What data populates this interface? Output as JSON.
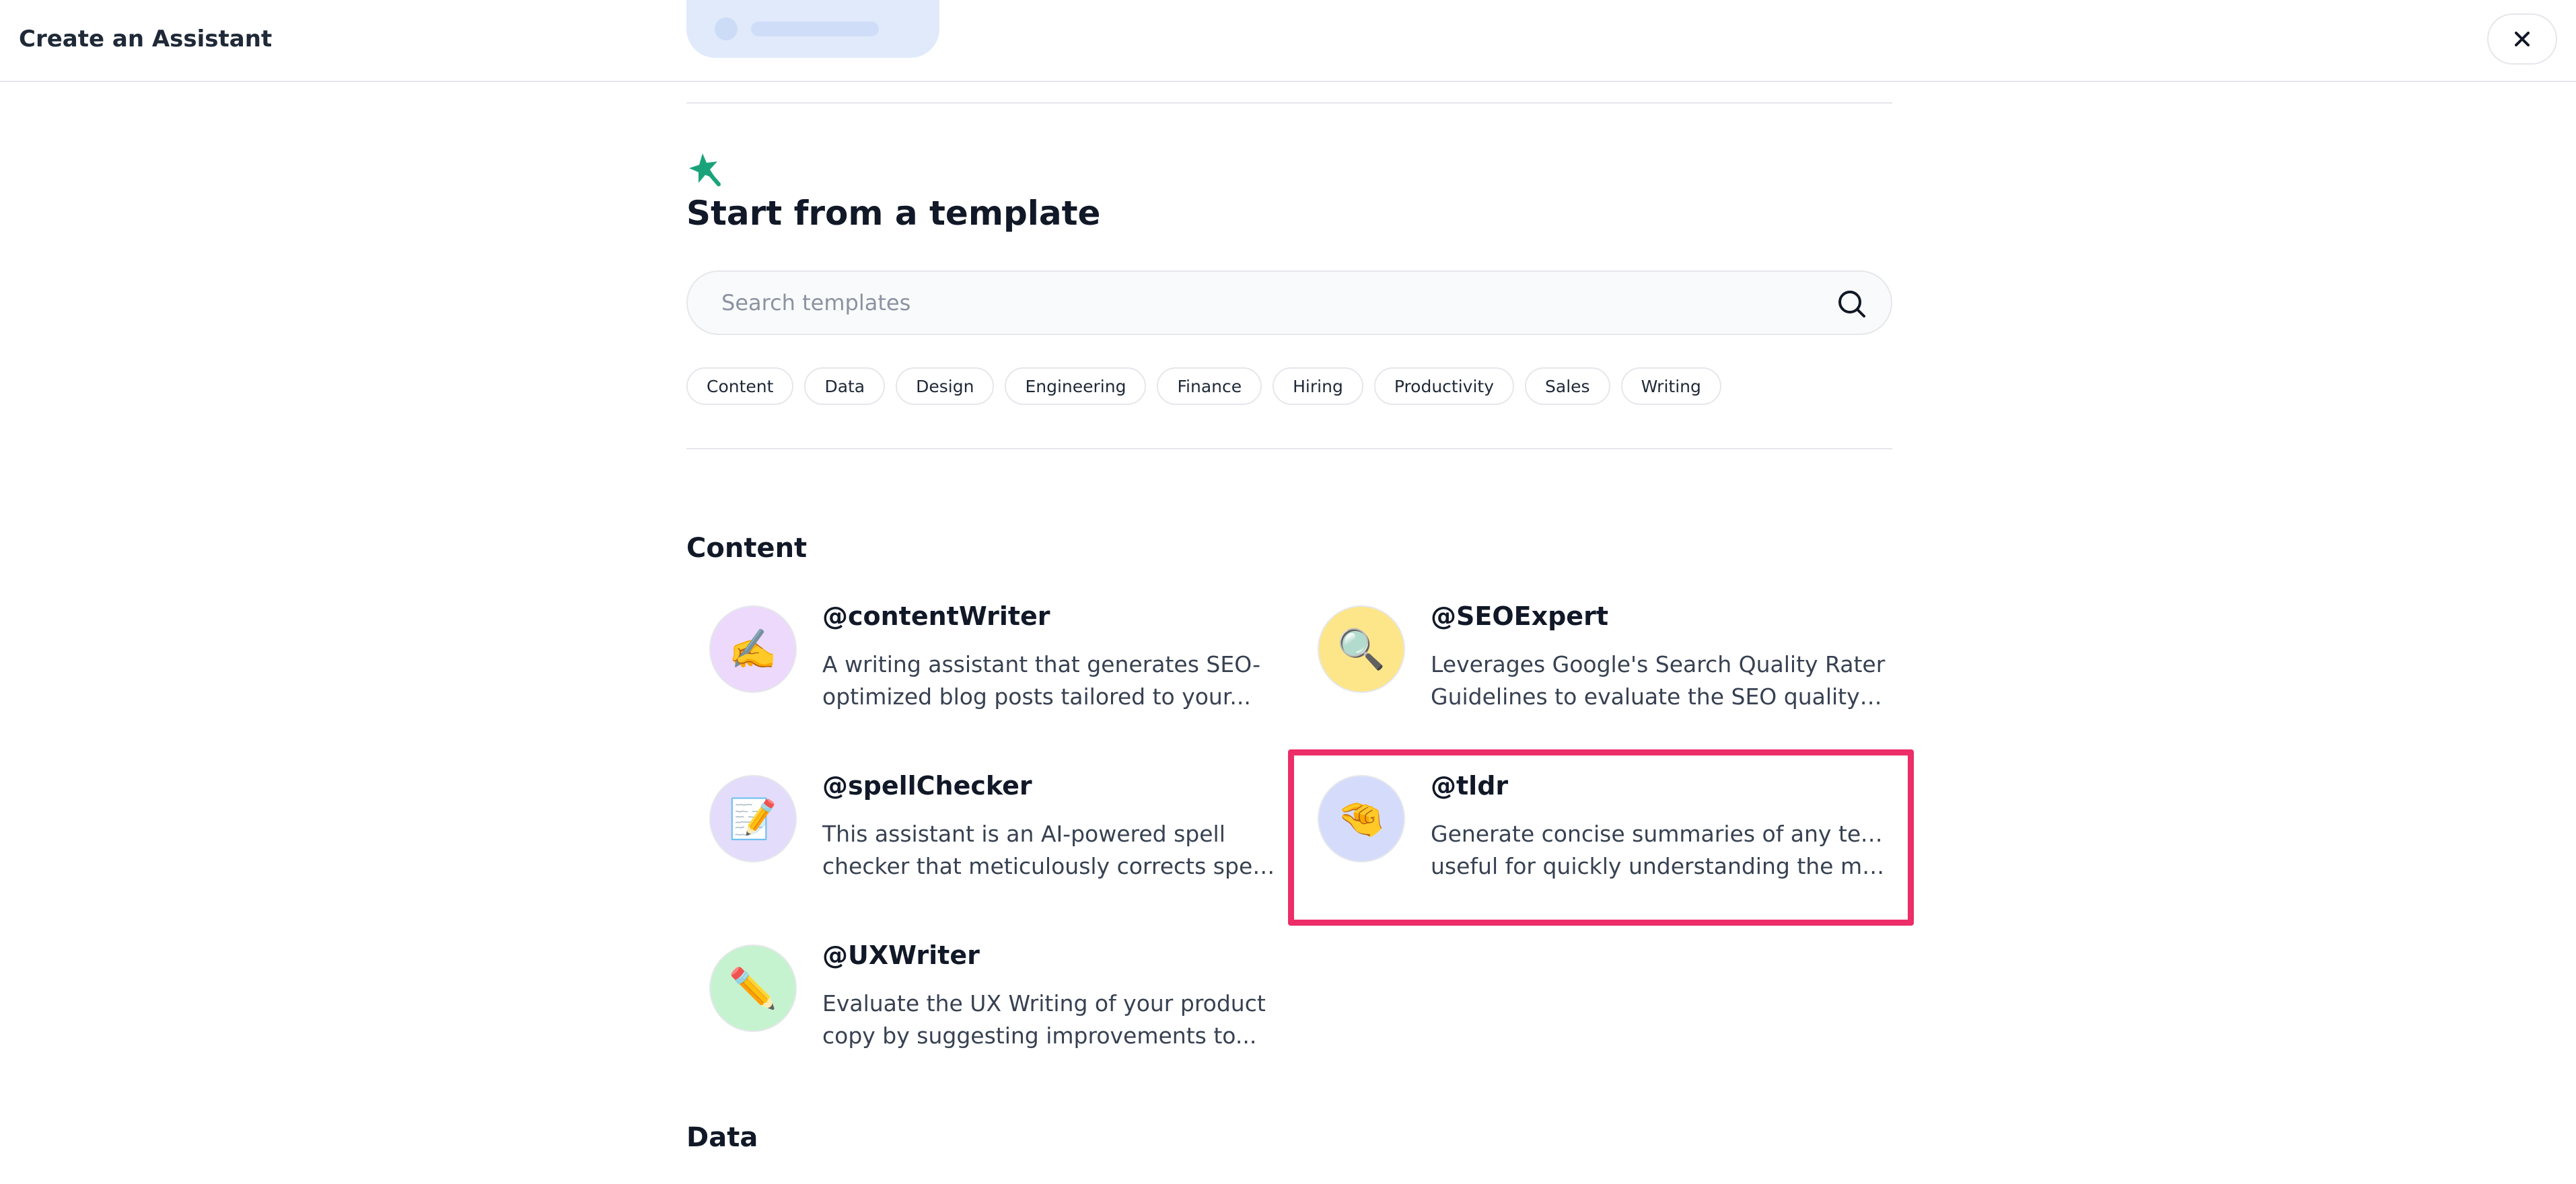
{
  "header": {
    "title": "Create an Assistant",
    "close_icon": "close-icon"
  },
  "templates": {
    "heading": "Start from a template",
    "search_placeholder": "Search templates",
    "tags": [
      "Content",
      "Data",
      "Design",
      "Engineering",
      "Finance",
      "Hiring",
      "Productivity",
      "Sales",
      "Writing"
    ]
  },
  "categories": [
    {
      "title": "Content",
      "assistants": [
        {
          "name": "@contentWriter",
          "emoji": "✍️",
          "avatar_color": "#ecd9fb",
          "desc_line1": "A writing assistant that generates SEO-",
          "desc_line2": "optimized blog posts tailored to your..."
        },
        {
          "name": "@SEOExpert",
          "emoji": "🔍",
          "avatar_color": "#fde68a",
          "desc_line1": "Leverages Google's Search Quality Rater",
          "desc_line2": "Guidelines to evaluate the SEO quality of..."
        },
        {
          "name": "@spellChecker",
          "emoji": "📝",
          "avatar_color": "#e3dcfb",
          "desc_line1": "This assistant is an AI-powered spell",
          "desc_line2": "checker that meticulously corrects spellin..."
        },
        {
          "name": "@tldr",
          "emoji": "🤏",
          "avatar_color": "#d5dcfb",
          "desc_line1": "Generate concise summaries of any text. It's",
          "desc_line2": "useful for quickly understanding the main..."
        },
        {
          "name": "@UXWriter",
          "emoji": "✏️",
          "avatar_color": "#c6f3cf",
          "desc_line1": "Evaluate the UX Writing of your product",
          "desc_line2": "copy by suggesting improvements to..."
        }
      ]
    },
    {
      "title": "Data"
    }
  ],
  "colors": {
    "accent_highlight": "#ec2d68",
    "star_icon": "#1aa37a",
    "faded_button": "#dbe7fb"
  }
}
